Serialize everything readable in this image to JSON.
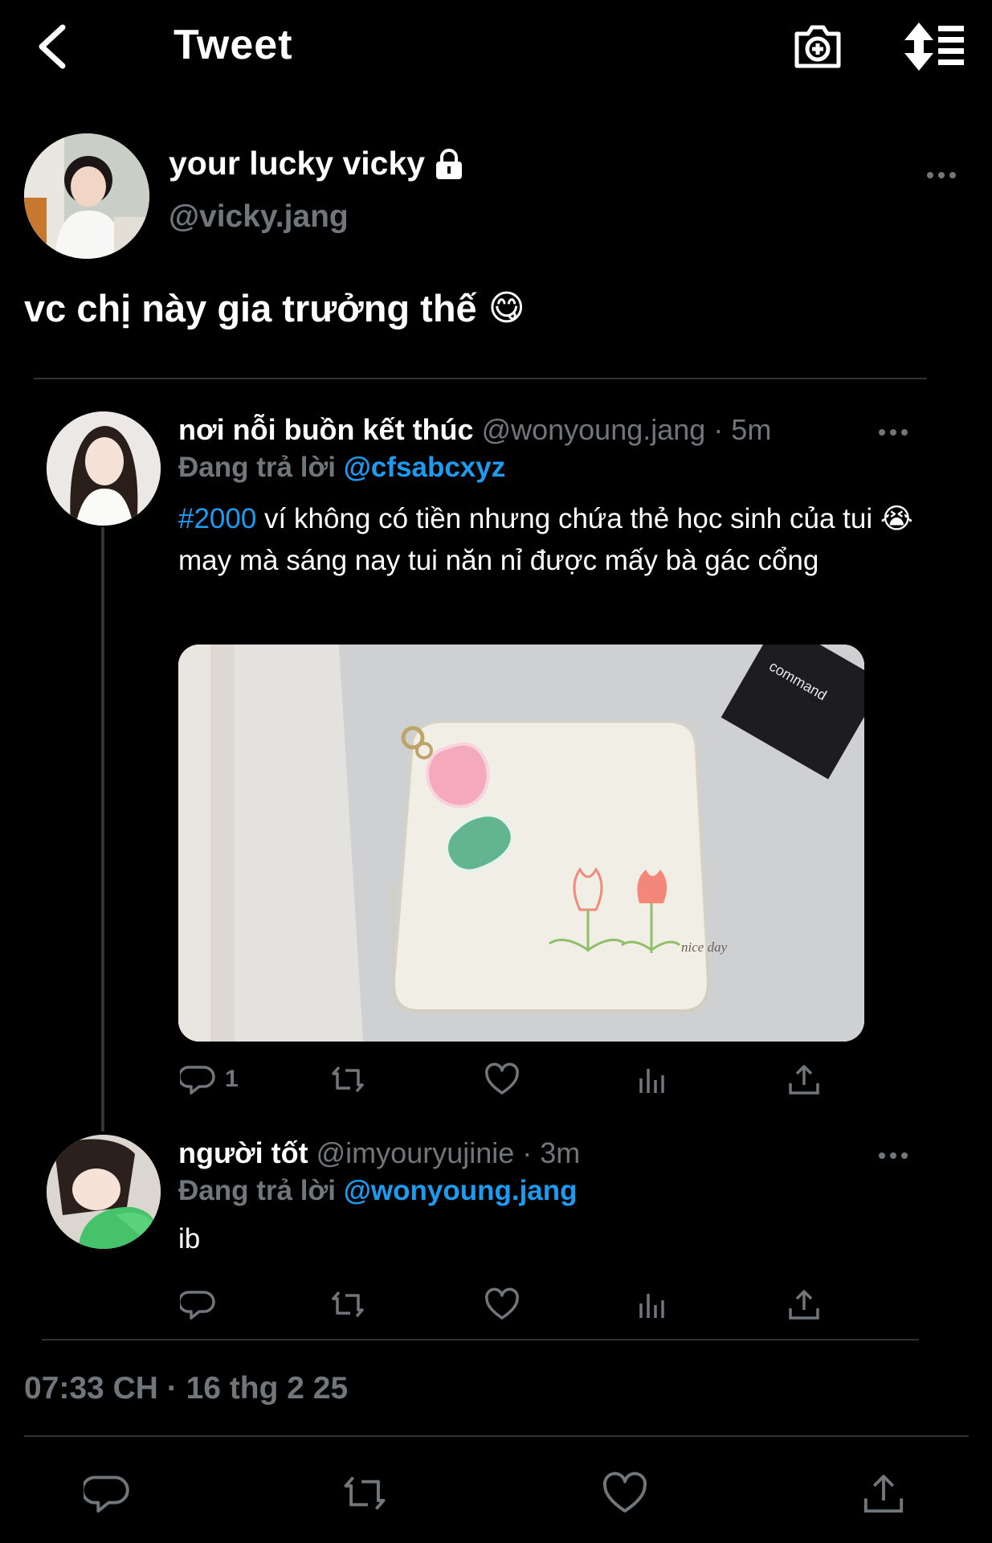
{
  "header": {
    "title": "Tweet",
    "back_icon": "back-chevron-icon",
    "camera_icon": "add-photo-icon",
    "sort_icon": "sort-icon"
  },
  "main_tweet": {
    "author_name": "your lucky vicky",
    "handle": "@vicky.jang",
    "text": "vc chị này gia trưởng thế",
    "emoji": "😋",
    "timestamp": "07:33 CH · 16 thg 2 25"
  },
  "replies": [
    {
      "name": "nơi nỗi buồn kết thúc",
      "meta": "@wonyoung.jang · 5m",
      "replying_prefix": "Đang trả lời",
      "replying_to": "@cfsabcxyz",
      "hashtag": "#2000",
      "text_1": " ví không có tiền nhưng chứa thẻ học sinh của tui ",
      "emoji": "😭",
      "text_2": " may mà sáng nay tui năn nỉ được mấy bà gác cổng",
      "image_label_1": "command",
      "image_label_2": "nice day",
      "reply_count": "1"
    },
    {
      "name": "người tốt",
      "meta": "@imyouryujinie · 3m",
      "replying_prefix": "Đang trả lời",
      "replying_to": "@wonyoung.jang",
      "text": "ib",
      "reply_count": ""
    }
  ],
  "colors": {
    "background": "#000000",
    "text": "#ffffff",
    "muted": "#71767b",
    "accent": "#1d9bf0",
    "divider": "#2f3336"
  }
}
